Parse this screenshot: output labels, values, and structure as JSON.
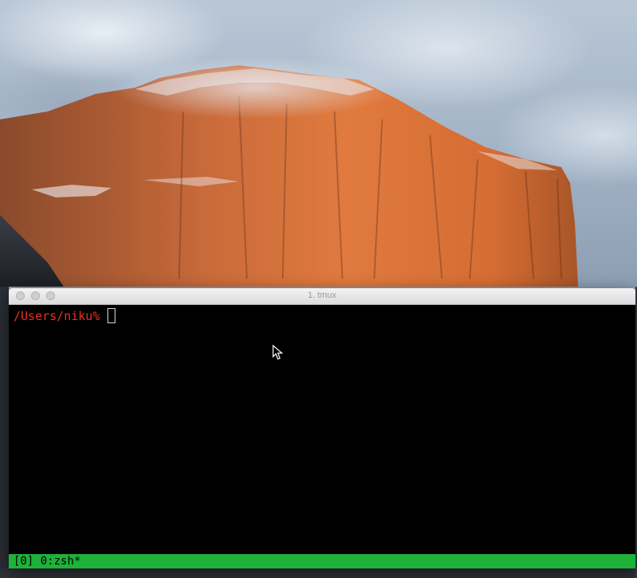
{
  "window": {
    "title": "1. tmux"
  },
  "terminal": {
    "prompt": "/Users/niku%",
    "input": ""
  },
  "status_bar": {
    "session": "[0]",
    "window_label": "0:zsh*",
    "color": "#1fb23a"
  },
  "colors": {
    "prompt": "#e8321a",
    "terminal_bg": "#000000"
  },
  "icons": [
    "close-button-icon",
    "minimize-button-icon",
    "zoom-button-icon",
    "mouse-pointer-icon"
  ]
}
